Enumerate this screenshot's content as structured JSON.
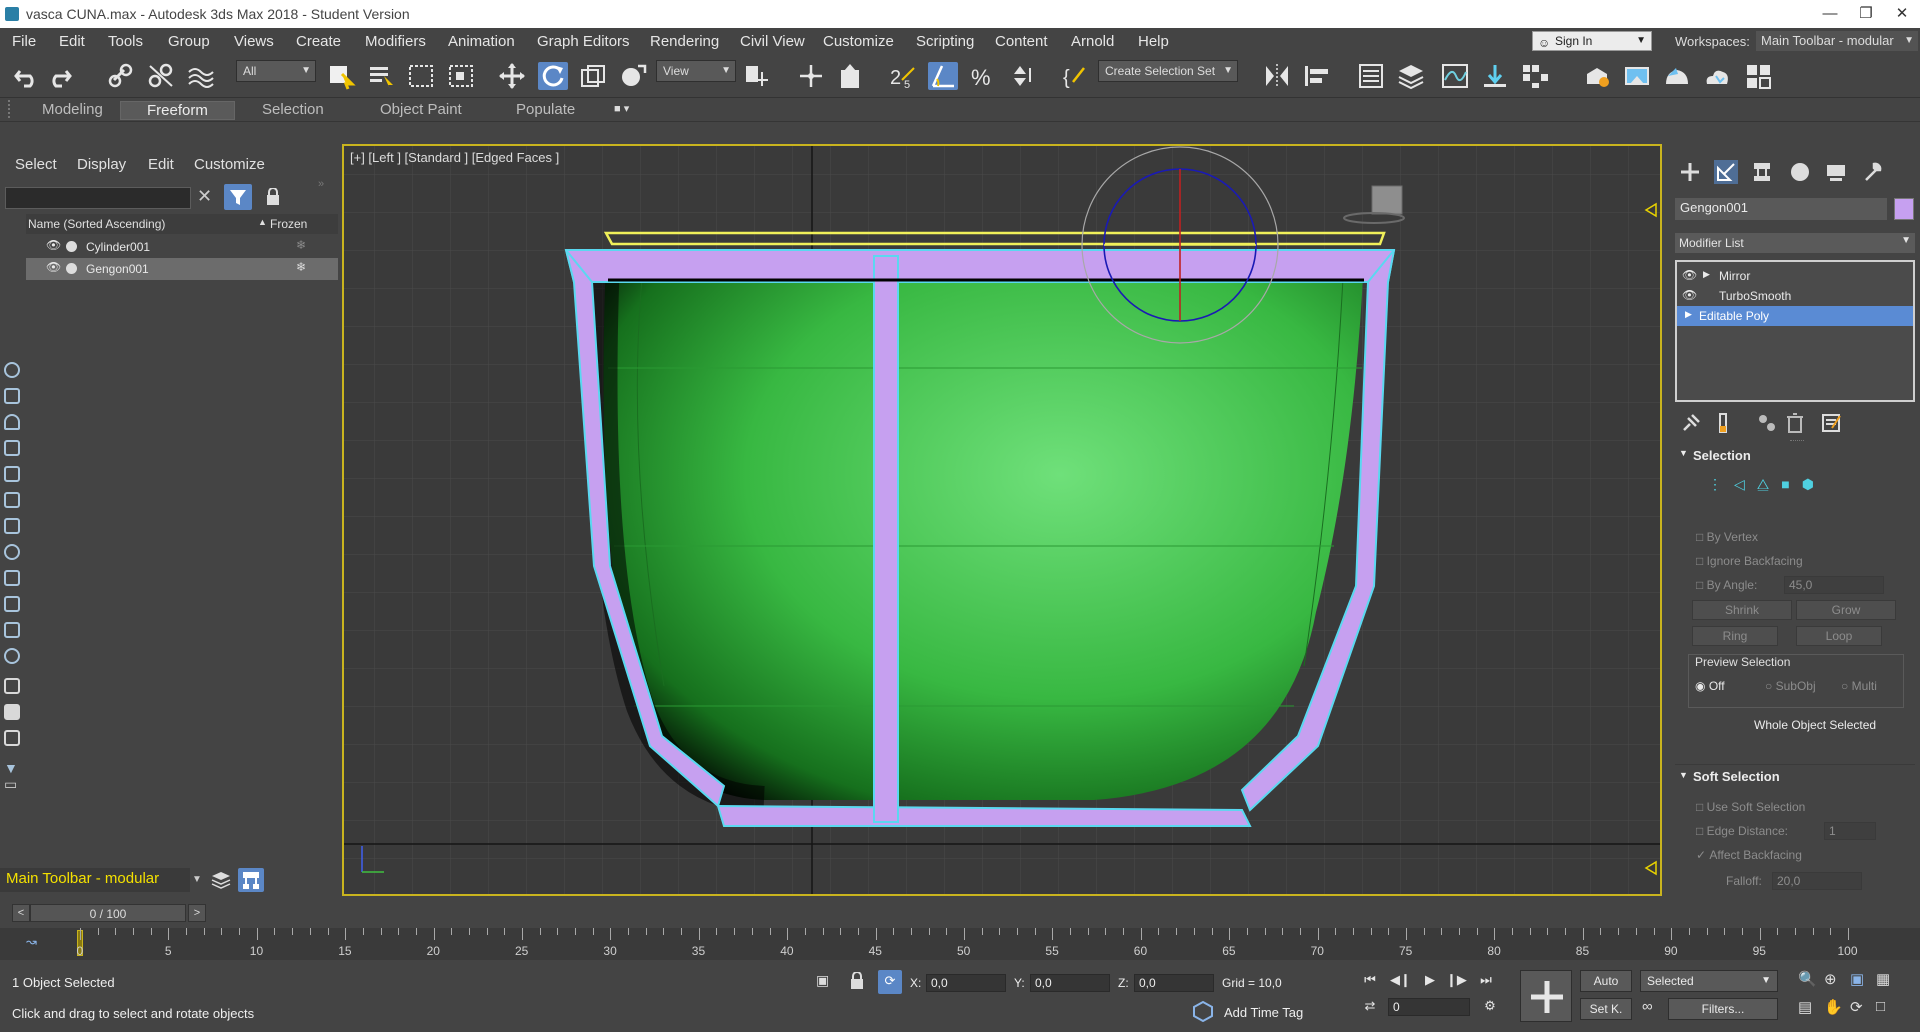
{
  "window": {
    "title": "vasca CUNA.max - Autodesk 3ds Max 2018 - Student Version"
  },
  "menu": [
    "File",
    "Edit",
    "Tools",
    "Group",
    "Views",
    "Create",
    "Modifiers",
    "Animation",
    "Graph Editors",
    "Rendering",
    "Civil View",
    "Customize",
    "Scripting",
    "Content",
    "Arnold",
    "Help"
  ],
  "account": {
    "sign_in": "Sign In",
    "workspaces_label": "Workspaces:",
    "workspace_value": "Main Toolbar - modular"
  },
  "toolbar": {
    "filter_value": "All",
    "ref_coord": "View",
    "selection_set": "Create Selection Set"
  },
  "ribbon": {
    "tabs": [
      "Modeling",
      "Freeform",
      "Selection",
      "Object Paint",
      "Populate"
    ],
    "active": "Freeform"
  },
  "scene_explorer": {
    "menus": [
      "Select",
      "Display",
      "Edit",
      "Customize"
    ],
    "column_name": "Name (Sorted Ascending)",
    "column_frozen": "Frozen",
    "rows": [
      {
        "name": "Cylinder001",
        "selected": false
      },
      {
        "name": "Gengon001",
        "selected": true
      }
    ],
    "toolbar_label": "Main Toolbar - modular"
  },
  "viewport": {
    "label": "[+] [Left ] [Standard ] [Edged Faces ]"
  },
  "command_panel": {
    "object_name": "Gengon001",
    "object_color": "#c6a0f0",
    "modifier_list": "Modifier List",
    "stack": [
      {
        "name": "Mirror",
        "selected": false
      },
      {
        "name": "TurboSmooth",
        "selected": false
      },
      {
        "name": "Editable Poly",
        "selected": true
      }
    ],
    "selection": {
      "title": "Selection",
      "by_vertex": "By Vertex",
      "ignore_backfacing": "Ignore Backfacing",
      "by_angle": "By Angle:",
      "angle_value": "45,0",
      "shrink": "Shrink",
      "grow": "Grow",
      "ring": "Ring",
      "loop": "Loop",
      "preview_title": "Preview Selection",
      "preview_off": "Off",
      "preview_subobj": "SubObj",
      "preview_multi": "Multi",
      "status": "Whole Object Selected"
    },
    "soft_selection": {
      "title": "Soft Selection",
      "use_soft": "Use Soft Selection",
      "edge_distance": "Edge Distance:",
      "edge_value": "1",
      "affect_backfacing": "Affect Backfacing",
      "falloff": "Falloff:",
      "falloff_value": "20,0"
    }
  },
  "timeline": {
    "frame_display": "0 / 100",
    "ticks": [
      0,
      5,
      10,
      15,
      20,
      25,
      30,
      35,
      40,
      45,
      50,
      55,
      60,
      65,
      70,
      75,
      80,
      85,
      90,
      95,
      100
    ]
  },
  "status": {
    "selection": "1 Object Selected",
    "prompt": "Click and drag to select and rotate objects",
    "x_label": "X:",
    "x": "0,0",
    "y_label": "Y:",
    "y": "0,0",
    "z_label": "Z:",
    "z": "0,0",
    "grid": "Grid = 10,0",
    "add_time_tag": "Add Time Tag",
    "auto_key": "Auto",
    "set_key": "Set K.",
    "key_mode": "Selected",
    "filters": "Filters...",
    "current_frame": "0"
  },
  "colors": {
    "accent": "#5b87c6",
    "viewport_border": "#c9b41e",
    "mesh_green": "#3fbf40",
    "cage_purple": "#c6a0f0"
  }
}
